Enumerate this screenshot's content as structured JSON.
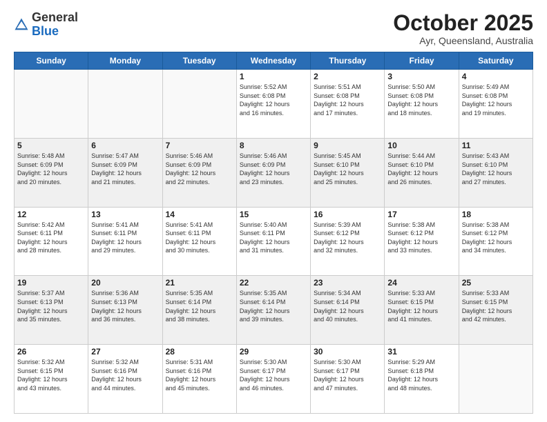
{
  "header": {
    "logo_general": "General",
    "logo_blue": "Blue",
    "month_title": "October 2025",
    "location": "Ayr, Queensland, Australia"
  },
  "weekdays": [
    "Sunday",
    "Monday",
    "Tuesday",
    "Wednesday",
    "Thursday",
    "Friday",
    "Saturday"
  ],
  "weeks": [
    [
      {
        "day": "",
        "lines": []
      },
      {
        "day": "",
        "lines": []
      },
      {
        "day": "",
        "lines": []
      },
      {
        "day": "1",
        "lines": [
          "Sunrise: 5:52 AM",
          "Sunset: 6:08 PM",
          "Daylight: 12 hours",
          "and 16 minutes."
        ]
      },
      {
        "day": "2",
        "lines": [
          "Sunrise: 5:51 AM",
          "Sunset: 6:08 PM",
          "Daylight: 12 hours",
          "and 17 minutes."
        ]
      },
      {
        "day": "3",
        "lines": [
          "Sunrise: 5:50 AM",
          "Sunset: 6:08 PM",
          "Daylight: 12 hours",
          "and 18 minutes."
        ]
      },
      {
        "day": "4",
        "lines": [
          "Sunrise: 5:49 AM",
          "Sunset: 6:08 PM",
          "Daylight: 12 hours",
          "and 19 minutes."
        ]
      }
    ],
    [
      {
        "day": "5",
        "lines": [
          "Sunrise: 5:48 AM",
          "Sunset: 6:09 PM",
          "Daylight: 12 hours",
          "and 20 minutes."
        ]
      },
      {
        "day": "6",
        "lines": [
          "Sunrise: 5:47 AM",
          "Sunset: 6:09 PM",
          "Daylight: 12 hours",
          "and 21 minutes."
        ]
      },
      {
        "day": "7",
        "lines": [
          "Sunrise: 5:46 AM",
          "Sunset: 6:09 PM",
          "Daylight: 12 hours",
          "and 22 minutes."
        ]
      },
      {
        "day": "8",
        "lines": [
          "Sunrise: 5:46 AM",
          "Sunset: 6:09 PM",
          "Daylight: 12 hours",
          "and 23 minutes."
        ]
      },
      {
        "day": "9",
        "lines": [
          "Sunrise: 5:45 AM",
          "Sunset: 6:10 PM",
          "Daylight: 12 hours",
          "and 25 minutes."
        ]
      },
      {
        "day": "10",
        "lines": [
          "Sunrise: 5:44 AM",
          "Sunset: 6:10 PM",
          "Daylight: 12 hours",
          "and 26 minutes."
        ]
      },
      {
        "day": "11",
        "lines": [
          "Sunrise: 5:43 AM",
          "Sunset: 6:10 PM",
          "Daylight: 12 hours",
          "and 27 minutes."
        ]
      }
    ],
    [
      {
        "day": "12",
        "lines": [
          "Sunrise: 5:42 AM",
          "Sunset: 6:11 PM",
          "Daylight: 12 hours",
          "and 28 minutes."
        ]
      },
      {
        "day": "13",
        "lines": [
          "Sunrise: 5:41 AM",
          "Sunset: 6:11 PM",
          "Daylight: 12 hours",
          "and 29 minutes."
        ]
      },
      {
        "day": "14",
        "lines": [
          "Sunrise: 5:41 AM",
          "Sunset: 6:11 PM",
          "Daylight: 12 hours",
          "and 30 minutes."
        ]
      },
      {
        "day": "15",
        "lines": [
          "Sunrise: 5:40 AM",
          "Sunset: 6:11 PM",
          "Daylight: 12 hours",
          "and 31 minutes."
        ]
      },
      {
        "day": "16",
        "lines": [
          "Sunrise: 5:39 AM",
          "Sunset: 6:12 PM",
          "Daylight: 12 hours",
          "and 32 minutes."
        ]
      },
      {
        "day": "17",
        "lines": [
          "Sunrise: 5:38 AM",
          "Sunset: 6:12 PM",
          "Daylight: 12 hours",
          "and 33 minutes."
        ]
      },
      {
        "day": "18",
        "lines": [
          "Sunrise: 5:38 AM",
          "Sunset: 6:12 PM",
          "Daylight: 12 hours",
          "and 34 minutes."
        ]
      }
    ],
    [
      {
        "day": "19",
        "lines": [
          "Sunrise: 5:37 AM",
          "Sunset: 6:13 PM",
          "Daylight: 12 hours",
          "and 35 minutes."
        ]
      },
      {
        "day": "20",
        "lines": [
          "Sunrise: 5:36 AM",
          "Sunset: 6:13 PM",
          "Daylight: 12 hours",
          "and 36 minutes."
        ]
      },
      {
        "day": "21",
        "lines": [
          "Sunrise: 5:35 AM",
          "Sunset: 6:14 PM",
          "Daylight: 12 hours",
          "and 38 minutes."
        ]
      },
      {
        "day": "22",
        "lines": [
          "Sunrise: 5:35 AM",
          "Sunset: 6:14 PM",
          "Daylight: 12 hours",
          "and 39 minutes."
        ]
      },
      {
        "day": "23",
        "lines": [
          "Sunrise: 5:34 AM",
          "Sunset: 6:14 PM",
          "Daylight: 12 hours",
          "and 40 minutes."
        ]
      },
      {
        "day": "24",
        "lines": [
          "Sunrise: 5:33 AM",
          "Sunset: 6:15 PM",
          "Daylight: 12 hours",
          "and 41 minutes."
        ]
      },
      {
        "day": "25",
        "lines": [
          "Sunrise: 5:33 AM",
          "Sunset: 6:15 PM",
          "Daylight: 12 hours",
          "and 42 minutes."
        ]
      }
    ],
    [
      {
        "day": "26",
        "lines": [
          "Sunrise: 5:32 AM",
          "Sunset: 6:15 PM",
          "Daylight: 12 hours",
          "and 43 minutes."
        ]
      },
      {
        "day": "27",
        "lines": [
          "Sunrise: 5:32 AM",
          "Sunset: 6:16 PM",
          "Daylight: 12 hours",
          "and 44 minutes."
        ]
      },
      {
        "day": "28",
        "lines": [
          "Sunrise: 5:31 AM",
          "Sunset: 6:16 PM",
          "Daylight: 12 hours",
          "and 45 minutes."
        ]
      },
      {
        "day": "29",
        "lines": [
          "Sunrise: 5:30 AM",
          "Sunset: 6:17 PM",
          "Daylight: 12 hours",
          "and 46 minutes."
        ]
      },
      {
        "day": "30",
        "lines": [
          "Sunrise: 5:30 AM",
          "Sunset: 6:17 PM",
          "Daylight: 12 hours",
          "and 47 minutes."
        ]
      },
      {
        "day": "31",
        "lines": [
          "Sunrise: 5:29 AM",
          "Sunset: 6:18 PM",
          "Daylight: 12 hours",
          "and 48 minutes."
        ]
      },
      {
        "day": "",
        "lines": []
      }
    ]
  ]
}
